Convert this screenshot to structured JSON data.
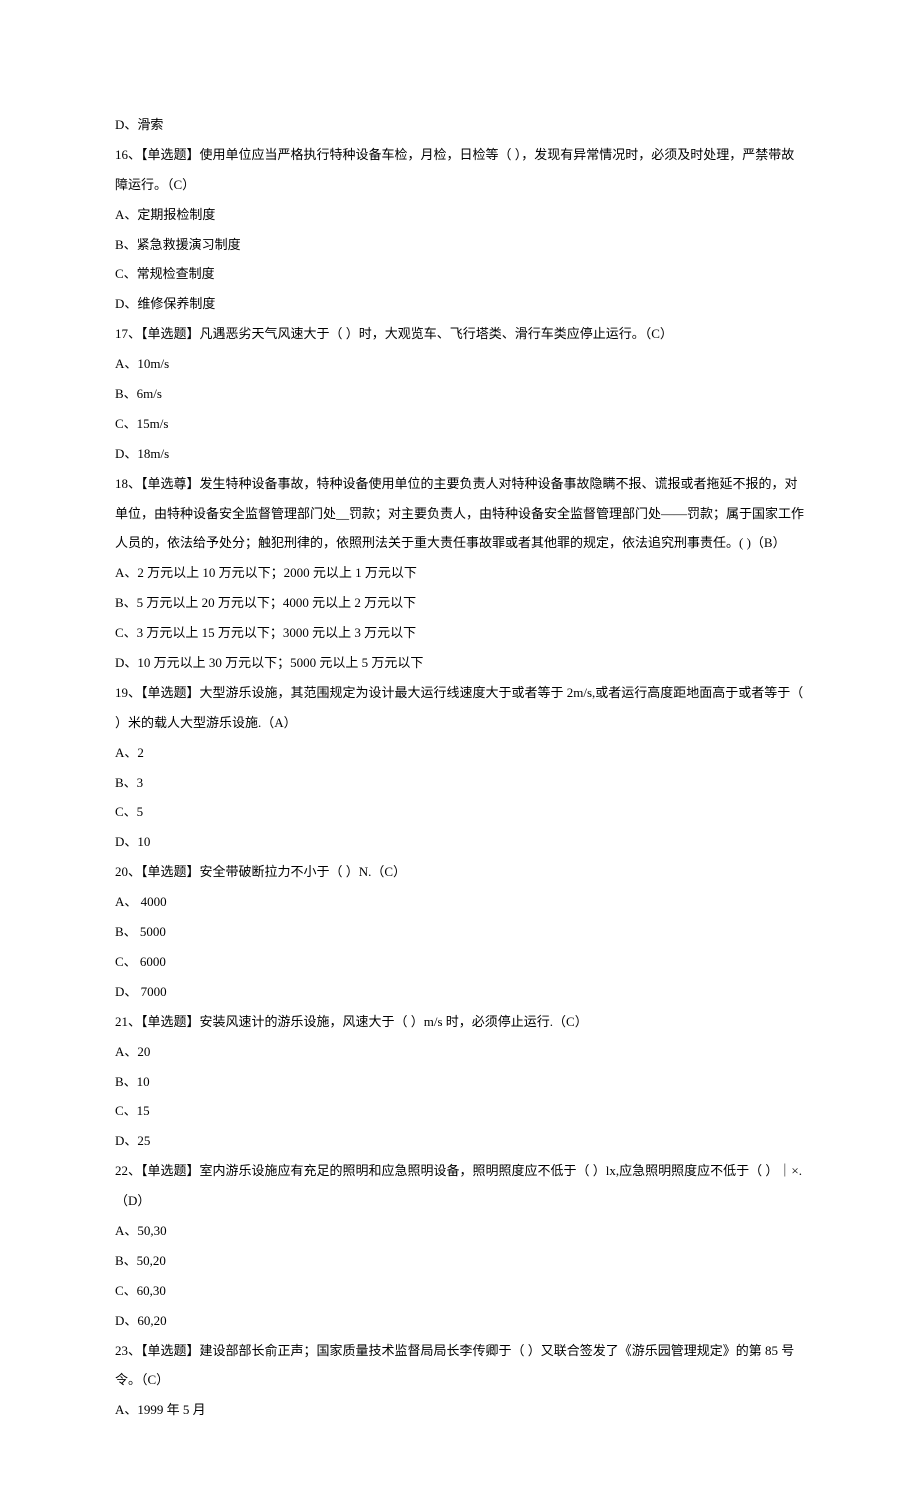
{
  "lines": [
    "D、滑索",
    "16、【单选题】使用单位应当严格执行特种设备车检，月检，日检等（ ），发现有异常情况时，必须及时处理，严禁带故障运行。（C）",
    "A、定期报检制度",
    "B、紧急救援演习制度",
    "C、常规检查制度",
    "D、维修保养制度",
    "17、【单选题】凡遇恶劣天气风速大于（ ）时，大观览车、飞行塔类、滑行车类应停止运行。（C）",
    "A、10m/s",
    "B、6m/s",
    "C、15m/s",
    "D、18m/s",
    "18、【单选尊】发生特种设备事故，特种设备使用单位的主要负责人对特种设备事故隐瞒不报、谎报或者拖延不报的，对单位，由特种设备安全监督管理部门处__罚款；对主要负责人，由特种设备安全监督管理部门处——罚款；属于国家工作人员的，依法给予处分；触犯刑律的，依照刑法关于重大责任事故罪或者其他罪的规定，依法追究刑事责任。( )（B）",
    "A、2 万元以上 10 万元以下；2000 元以上 1 万元以下",
    "B、5 万元以上 20 万元以下；4000 元以上 2 万元以下",
    "C、3 万元以上 15 万元以下；3000 元以上 3 万元以下",
    "D、10 万元以上 30 万元以下；5000 元以上 5 万元以下",
    "19、【单选题】大型游乐设施，其范围规定为设计最大运行线速度大于或者等于 2m/s,或者运行高度距地面高于或者等于（ ）米的载人大型游乐设施.（A）",
    "A、2",
    "B、3",
    "C、5",
    "D、10",
    "20、【单选题】安全带破断拉力不小于（ ）N.（C）",
    "A、 4000",
    "B、 5000",
    "C、 6000",
    "D、 7000",
    "21、【单选题】安装风速计的游乐设施，风速大于（ ）m/s 时，必须停止运行.（C）",
    "A、20",
    "B、10",
    "C、15",
    "D、25",
    "22、【单选题】室内游乐设施应有充足的照明和应急照明设备，照明照度应不低于（ ）lx,应急照明照度应不低于（ ）｜×.（D）",
    "A、50,30",
    "B、50,20",
    "C、60,30",
    "D、60,20",
    "23、【单选题】建设部部长俞正声；国家质量技术监督局局长李传卿于（ ）又联合签发了《游乐园管理规定》的第 85 号令。（C）",
    "A、1999 年 5 月"
  ]
}
